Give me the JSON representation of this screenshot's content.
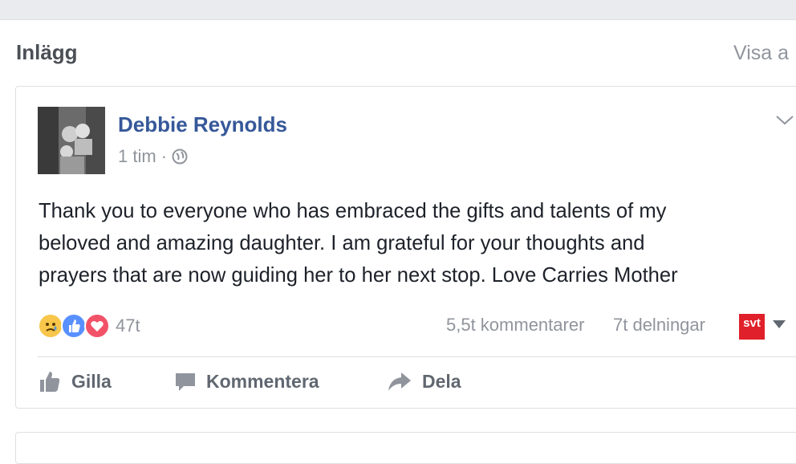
{
  "section": {
    "title": "Inlägg",
    "see_all": "Visa a"
  },
  "post": {
    "author": "Debbie Reynolds",
    "time": "1 tim",
    "separator": "·",
    "privacy_icon": "globe-icon",
    "text_lines": [
      "Thank you to everyone who has embraced the gifts and talents of my",
      "beloved and amazing daughter. I am grateful for your thoughts and",
      "prayers that are now guiding her to her next stop. Love Carries Mother"
    ],
    "reactions": {
      "icons": [
        "sad-reaction-icon",
        "like-reaction-icon",
        "love-reaction-icon"
      ],
      "count": "47t"
    },
    "comments": "5,5t kommentarer",
    "shares": "7t delningar",
    "page_logo_text": "svt"
  },
  "actions": {
    "like": "Gilla",
    "comment": "Kommentera",
    "share": "Dela"
  },
  "colors": {
    "author": "#365899",
    "muted": "#90949c",
    "like_blue": "#5890ff",
    "love_red": "#f25268",
    "sad_yellow": "#f7c64b",
    "svt_red": "#e0202a"
  }
}
